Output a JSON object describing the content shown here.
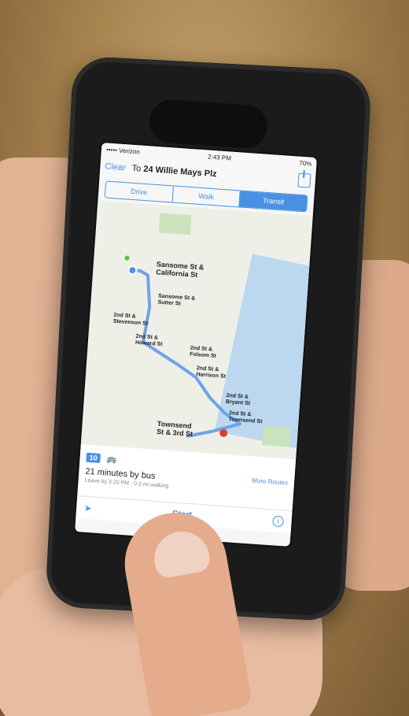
{
  "status_bar": {
    "carrier": "••••• Verizon",
    "time": "2:43 PM",
    "battery": "70%"
  },
  "header": {
    "clear_label": "Clear",
    "destination_prefix": "To",
    "destination": "24 Willie Mays Plz"
  },
  "mode_tabs": [
    {
      "label": "Drive",
      "active": false
    },
    {
      "label": "Walk",
      "active": false
    },
    {
      "label": "Transit",
      "active": true
    }
  ],
  "map": {
    "labels": [
      "Sansome St &",
      "California St",
      "Sansome St &",
      "Sutter St",
      "2nd St &",
      "Stevenson St",
      "2nd St &",
      "Howard St",
      "2nd St &",
      "Folsom St",
      "2nd St &",
      "Harrison St",
      "2nd St &",
      "Bryant St",
      "2nd St &",
      "Townsend St",
      "Townsend",
      "St & 3rd St"
    ]
  },
  "route": {
    "bus_number": "10",
    "summary": "21 minutes by bus",
    "detail": "Leave by 3:20 PM · 0.3 mi walking",
    "more_routes_label": "More Routes"
  },
  "toolbar": {
    "start_label": "Start"
  },
  "colors": {
    "accent": "#4a90e2",
    "route_line": "#6fa3e8",
    "water": "#bcd7f0",
    "park": "#c9e3bd"
  }
}
